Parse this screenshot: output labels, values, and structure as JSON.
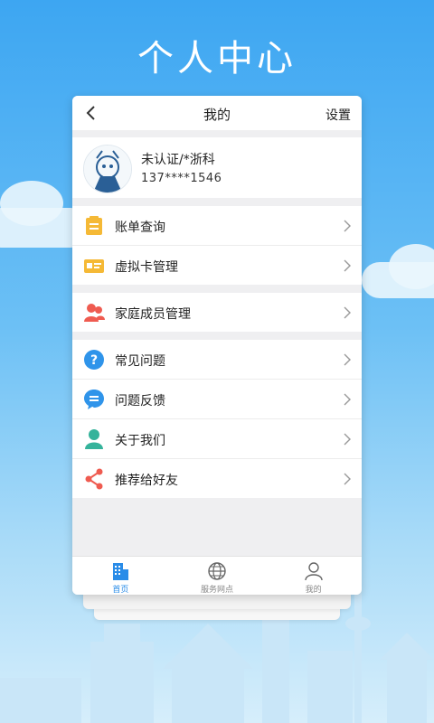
{
  "hero": {
    "title": "个人中心"
  },
  "navbar": {
    "title": "我的",
    "settings_label": "设置"
  },
  "profile": {
    "name": "未认证/*浙科",
    "phone": "137****1546"
  },
  "menu_groups": [
    {
      "items": [
        {
          "label": "账单查询",
          "icon": "bill-icon",
          "color": "#f5b936"
        },
        {
          "label": "虚拟卡管理",
          "icon": "card-icon",
          "color": "#f5b936"
        }
      ]
    },
    {
      "items": [
        {
          "label": "家庭成员管理",
          "icon": "family-icon",
          "color": "#ef5b50"
        }
      ]
    },
    {
      "items": [
        {
          "label": "常见问题",
          "icon": "question-icon",
          "color": "#2f94ea"
        },
        {
          "label": "问题反馈",
          "icon": "feedback-icon",
          "color": "#2f94ea"
        },
        {
          "label": "关于我们",
          "icon": "person-icon",
          "color": "#35b39b"
        },
        {
          "label": "推荐给好友",
          "icon": "share-icon",
          "color": "#ef5b50"
        }
      ]
    }
  ],
  "tabs": [
    {
      "label": "首页",
      "icon": "building-icon",
      "active": true
    },
    {
      "label": "服务网点",
      "icon": "globe-icon",
      "active": false
    },
    {
      "label": "我的",
      "icon": "user-icon",
      "active": false
    }
  ],
  "colors": {
    "accent": "#2a8ce8",
    "sky_top": "#3da6f2",
    "sky_bottom": "#d6eefb"
  }
}
